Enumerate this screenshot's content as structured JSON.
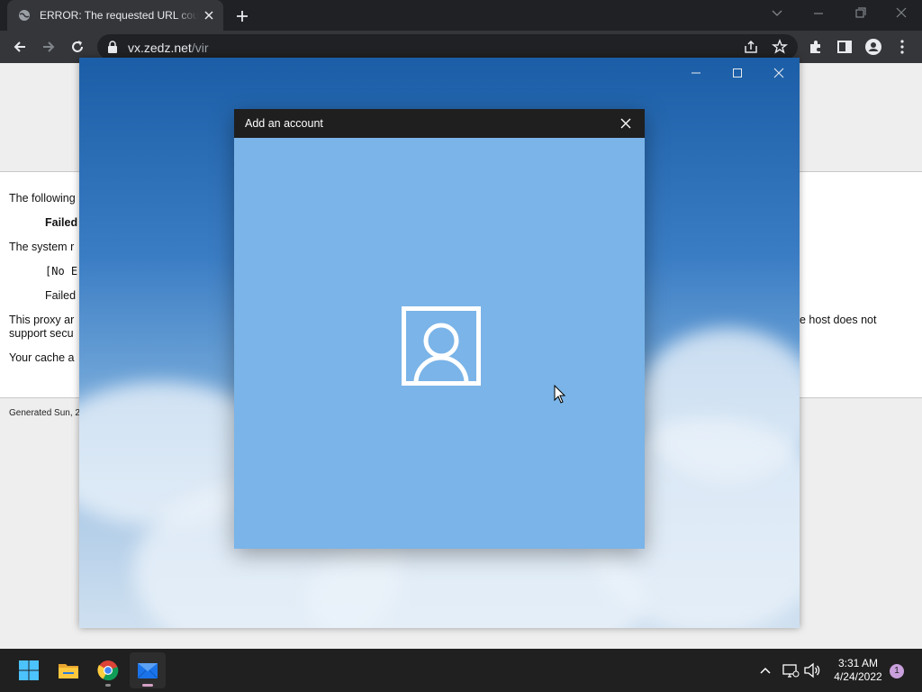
{
  "browser": {
    "tab_title": "ERROR: The requested URL could not be retrieved",
    "url_host": "vx.zedz.net",
    "url_path": "/vir"
  },
  "page": {
    "line1": "The following",
    "line2": "Failed",
    "line3": "The system r",
    "line4": "[No Er",
    "line5": "Failed",
    "line6": "This proxy ar",
    "line6_end": "e host does not",
    "line7": "support secu",
    "line8": "Your cache a",
    "footer": "Generated Sun, 2"
  },
  "dialog": {
    "title": "Add an account"
  },
  "taskbar": {
    "time": "3:31 AM",
    "date": "4/24/2022",
    "notification_count": "1",
    "apps": [
      "start-icon",
      "file-explorer-icon",
      "chrome-icon",
      "mail-icon"
    ]
  },
  "colors": {
    "dialog_body": "#7ab4e8",
    "dialog_titlebar": "#1f1f1f",
    "taskbar": "#202020"
  }
}
